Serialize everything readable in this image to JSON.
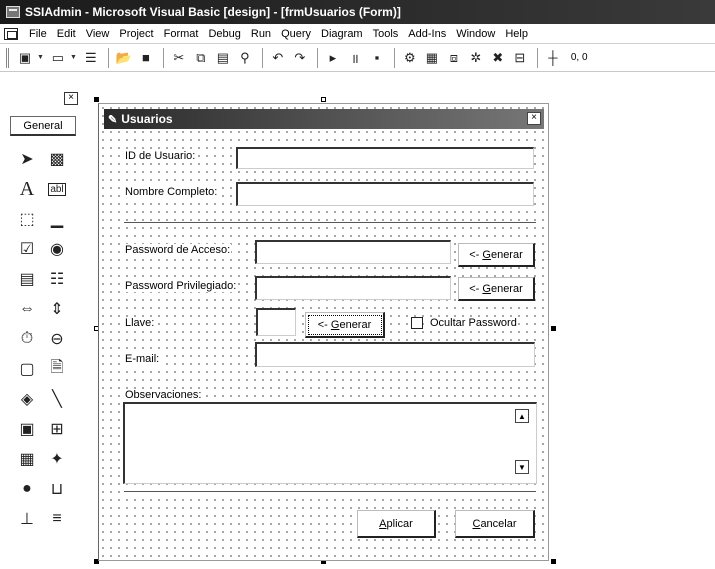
{
  "window": {
    "title": "SSIAdmin - Microsoft Visual Basic [design] - [frmUsuarios (Form)]"
  },
  "menu": {
    "items": [
      "File",
      "Edit",
      "View",
      "Project",
      "Format",
      "Debug",
      "Run",
      "Query",
      "Diagram",
      "Tools",
      "Add-Ins",
      "Window",
      "Help"
    ]
  },
  "toolbar": {
    "coords": "0, 0",
    "icons": [
      "add-project-icon",
      "add-form-icon",
      "menu-editor-icon",
      "open-icon",
      "save-icon",
      "cut-icon",
      "copy-icon",
      "paste-icon",
      "find-icon",
      "undo-icon",
      "redo-icon",
      "start-icon",
      "break-icon",
      "end-icon",
      "project-explorer-icon",
      "properties-icon",
      "form-layout-icon",
      "object-browser-icon",
      "toolbox-icon",
      "data-view-icon",
      "position-icon"
    ]
  },
  "toolbox": {
    "tab_label": "General",
    "close_glyph": "×",
    "tools": [
      "pointer",
      "picturebox",
      "label",
      "textbox",
      "frame",
      "commandbutton",
      "checkbox",
      "optionbutton",
      "combobox",
      "listbox",
      "hscrollbar",
      "vscrollbar",
      "timer",
      "drivelistbox",
      "dirlistbox",
      "filelistbox",
      "shape",
      "line",
      "image",
      "data",
      "ole",
      "extra1",
      "extra2",
      "extra3"
    ]
  },
  "form": {
    "title": "Usuarios",
    "close_glyph": "×",
    "fields": {
      "id_label": "ID de Usuario:",
      "id_value": "",
      "nombre_label": "Nombre Completo:",
      "nombre_value": "",
      "pass_acceso_label": "Password de Acceso:",
      "pass_acceso_value": "",
      "pass_priv_label": "Password Privilegiado:",
      "pass_priv_value": "",
      "llave_label": "Llave:",
      "llave_value": "",
      "email_label": "E-mail:",
      "email_value": "",
      "obs_label": "Observaciones:",
      "obs_value": ""
    },
    "buttons": {
      "generar_prefix": "<- ",
      "generar_hot": "G",
      "generar_rest": "enerar",
      "aplicar_hot": "A",
      "aplicar_rest": "plicar",
      "cancelar_hot": "C",
      "cancelar_rest": "ancelar"
    },
    "checkbox": {
      "ocultar_label": "Ocultar Password",
      "ocultar_checked": false
    }
  }
}
